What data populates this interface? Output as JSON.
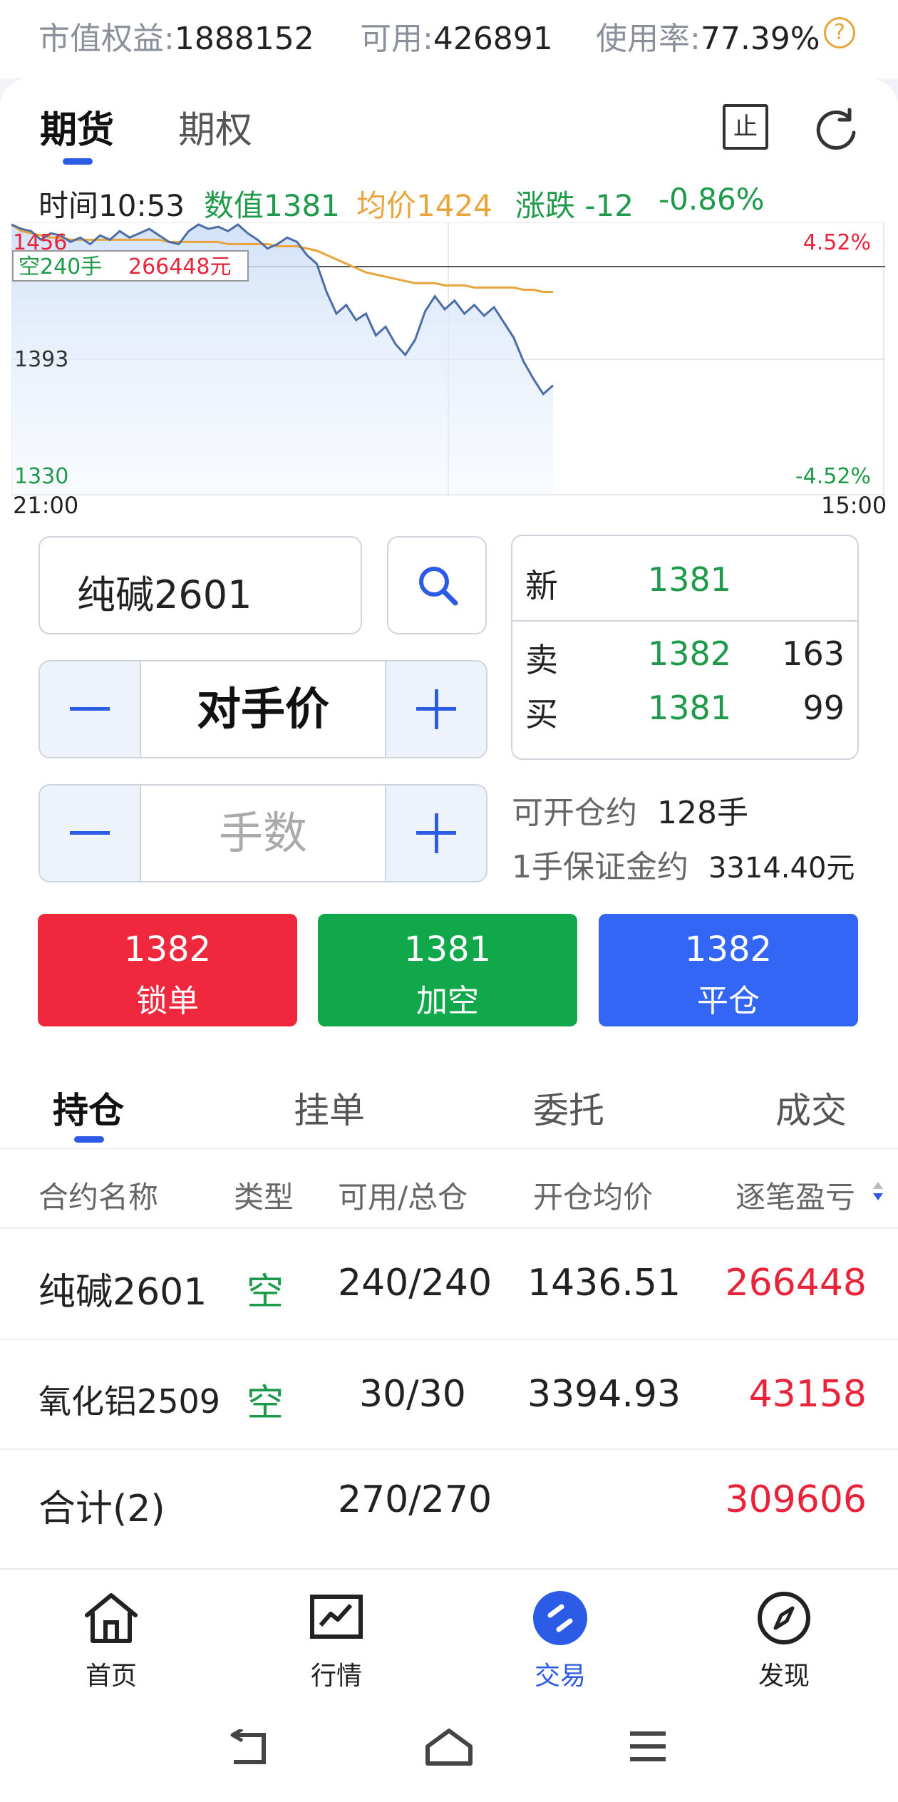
{
  "account": {
    "equity_label": "市值权益:",
    "equity_value": "1888152",
    "available_label": "可用:",
    "available_value": "426891",
    "usage_label": "使用率:",
    "usage_value": "77.39%",
    "help_glyph": "?"
  },
  "tabs": {
    "futures": "期货",
    "options": "期权"
  },
  "toolbar": {
    "stop_glyph": "止"
  },
  "tick": {
    "time": "时间10:53",
    "value": "数值1381",
    "avg": "均价1424",
    "change": "涨跌 -12",
    "change_pct": "-0.86%"
  },
  "chart_labels": {
    "ymax": "1456",
    "ymid": "1393",
    "ymin": "1330",
    "pct_max": "4.52%",
    "pct_min": "-4.52%",
    "t_start": "21:00",
    "t_end": "15:00",
    "position_tag": "空240手",
    "position_pnl": "266448元"
  },
  "chart_data": {
    "type": "line",
    "ylim": [
      1330,
      1456
    ],
    "xlim": [
      "21:00",
      "15:00"
    ],
    "grid": true,
    "series": [
      {
        "values": [
          1455,
          1453,
          1452,
          1448,
          1451,
          1450,
          1447,
          1449,
          1446,
          1450,
          1448,
          1452,
          1449,
          1451,
          1453,
          1450,
          1447,
          1446,
          1452,
          1455,
          1453,
          1454,
          1452,
          1455,
          1451,
          1448,
          1444,
          1446,
          1449,
          1447,
          1441,
          1437,
          1424,
          1414,
          1418,
          1411,
          1414,
          1404,
          1408,
          1400,
          1395,
          1402,
          1415,
          1422,
          1416,
          1420,
          1414,
          1418,
          1413,
          1417,
          1410,
          1403,
          1392,
          1384,
          1377,
          1381
        ]
      },
      {
        "values": [
          1455,
          1452,
          1451,
          1450,
          1449,
          1449,
          1448,
          1448,
          1448,
          1448,
          1448,
          1448,
          1448,
          1448,
          1448,
          1448,
          1447,
          1447,
          1447,
          1447,
          1447,
          1447,
          1446,
          1446,
          1446,
          1446,
          1446,
          1445,
          1445,
          1445,
          1444,
          1443,
          1441,
          1439,
          1437,
          1435,
          1433,
          1432,
          1431,
          1430,
          1429,
          1428,
          1428,
          1428,
          1427,
          1427,
          1427,
          1426,
          1426,
          1426,
          1426,
          1426,
          1425,
          1425,
          1424,
          1424
        ]
      }
    ]
  },
  "order": {
    "contract": "纯碱2601",
    "price_mode": "对手价",
    "qty_placeholder": "手数"
  },
  "quote": {
    "last_label": "新",
    "last_price": "1381",
    "ask_label": "卖",
    "ask_price": "1382",
    "ask_vol": "163",
    "bid_label": "买",
    "bid_price": "1381",
    "bid_vol": "99"
  },
  "margin": {
    "open_label": "可开仓约",
    "open_value": "128手",
    "per_lot_label": "1手保证金约",
    "per_lot_value": "3314.40元"
  },
  "actions": [
    {
      "price": "1382",
      "label": "锁单",
      "color": "#f0283e"
    },
    {
      "price": "1381",
      "label": "加空",
      "color": "#11a84b"
    },
    {
      "price": "1382",
      "label": "平仓",
      "color": "#3366f5"
    }
  ],
  "position_tabs": [
    "持仓",
    "挂单",
    "委托",
    "成交"
  ],
  "positions": {
    "headers": [
      "合约名称",
      "类型",
      "可用/总仓",
      "开仓均价",
      "逐笔盈亏"
    ],
    "rows": [
      {
        "name": "纯碱2601",
        "type": "空",
        "qty": "240/240",
        "avg": "1436.51",
        "pnl": "266448"
      },
      {
        "name": "氧化铝2509",
        "type": "空",
        "qty": "30/30",
        "avg": "3394.93",
        "pnl": "43158"
      }
    ],
    "total": {
      "label": "合计(2)",
      "qty": "270/270",
      "pnl": "309606"
    }
  },
  "nav": [
    "首页",
    "行情",
    "交易",
    "发现"
  ],
  "colors": {
    "accent": "#2c5be6",
    "up": "#e8233a",
    "down": "#1e9a4a",
    "avg_line": "#e9a53c"
  }
}
